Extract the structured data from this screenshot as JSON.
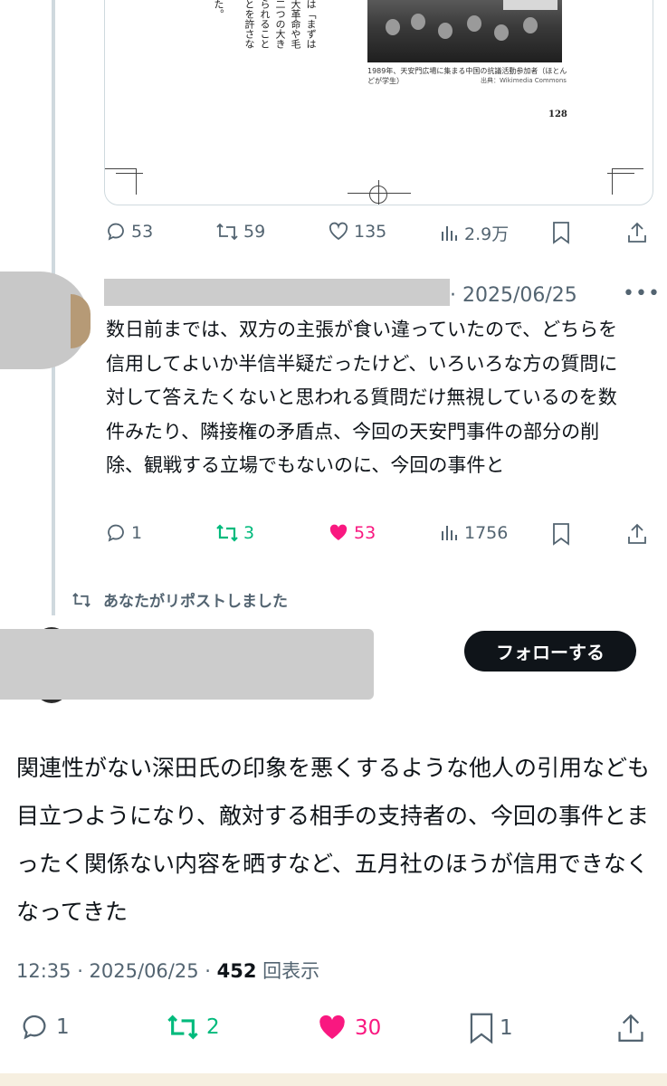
{
  "top_post": {
    "book_page": {
      "vertical_columns": [
        "は「まずは",
        "大革命や毛",
        "二つの大き",
        "られること",
        "とを許さな",
        "た。"
      ],
      "caption": "1989年、天安門広場に集まる中国の抗議活動参加者（ほとんどが学生）",
      "caption_source": "出典：Wikimedia Commons",
      "page_number": "128"
    },
    "actions": {
      "replies": "53",
      "reposts": "59",
      "likes": "135",
      "views": "2.9万"
    }
  },
  "reply": {
    "date": "· 2025/06/25",
    "text": "数日前までは、双方の主張が食い違っていたので、どちらを信用してよいか半信半疑だったけど、いろいろな方の質問に対して答えたくないと思われる質問だけ無視しているのを数件みたり、隣接権の矛盾点、今回の天安門事件の部分の削除、観戦する立場でもないのに、今回の事件と",
    "actions": {
      "replies": "1",
      "reposts": "3",
      "likes": "53",
      "views": "1756"
    }
  },
  "repost_notice": "あなたがリポストしました",
  "main_post": {
    "follow_label": "フォローする",
    "text": "関連性がない深田氏の印象を悪くするような他人の引用なども目立つようになり、敵対する相手の支持者の、今回の事件とまったく関係ない内容を晒すなど、五月社のほうが信用できなくなってきた",
    "time": "12:35 · 2025/06/25 · ",
    "view_count": "452",
    "view_label": "回表示",
    "actions": {
      "replies": "1",
      "reposts": "2",
      "likes": "30",
      "bookmarks": "1"
    }
  },
  "colors": {
    "text": "#0f1419",
    "muted": "#536471",
    "repost_green": "#00ba7c",
    "like_pink": "#f91880",
    "border": "#cfd9de"
  }
}
